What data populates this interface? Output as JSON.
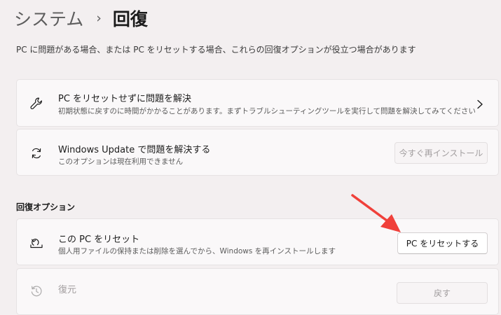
{
  "breadcrumb": {
    "parent": "システム",
    "separator": "›",
    "current": "回復"
  },
  "description": "PC に問題がある場合、または PC をリセットする場合、これらの回復オプションが役立つ場合があります",
  "cards": {
    "fix_without_reset": {
      "title": "PC をリセットせずに問題を解決",
      "subtitle": "初期状態に戻すのに時間がかかることがあります。まずトラブルシューティングツールを実行して問題を解決してみてください",
      "icon": "wrench-icon"
    },
    "windows_update": {
      "title": "Windows Update で問題を解決する",
      "subtitle": "このオプションは現在利用できません",
      "button_label": "今すぐ再インストール",
      "icon": "refresh-icon"
    }
  },
  "recovery_options": {
    "header": "回復オプション",
    "reset_pc": {
      "title": "この PC をリセット",
      "subtitle": "個人用ファイルの保持または削除を選んでから、Windows を再インストールします",
      "button_label": "PC をリセットする",
      "icon": "reset-pc-icon"
    },
    "go_back": {
      "title": "復元",
      "button_label": "戻す",
      "icon": "history-icon"
    }
  },
  "annotation": {
    "arrow_color": "#f0403a"
  }
}
